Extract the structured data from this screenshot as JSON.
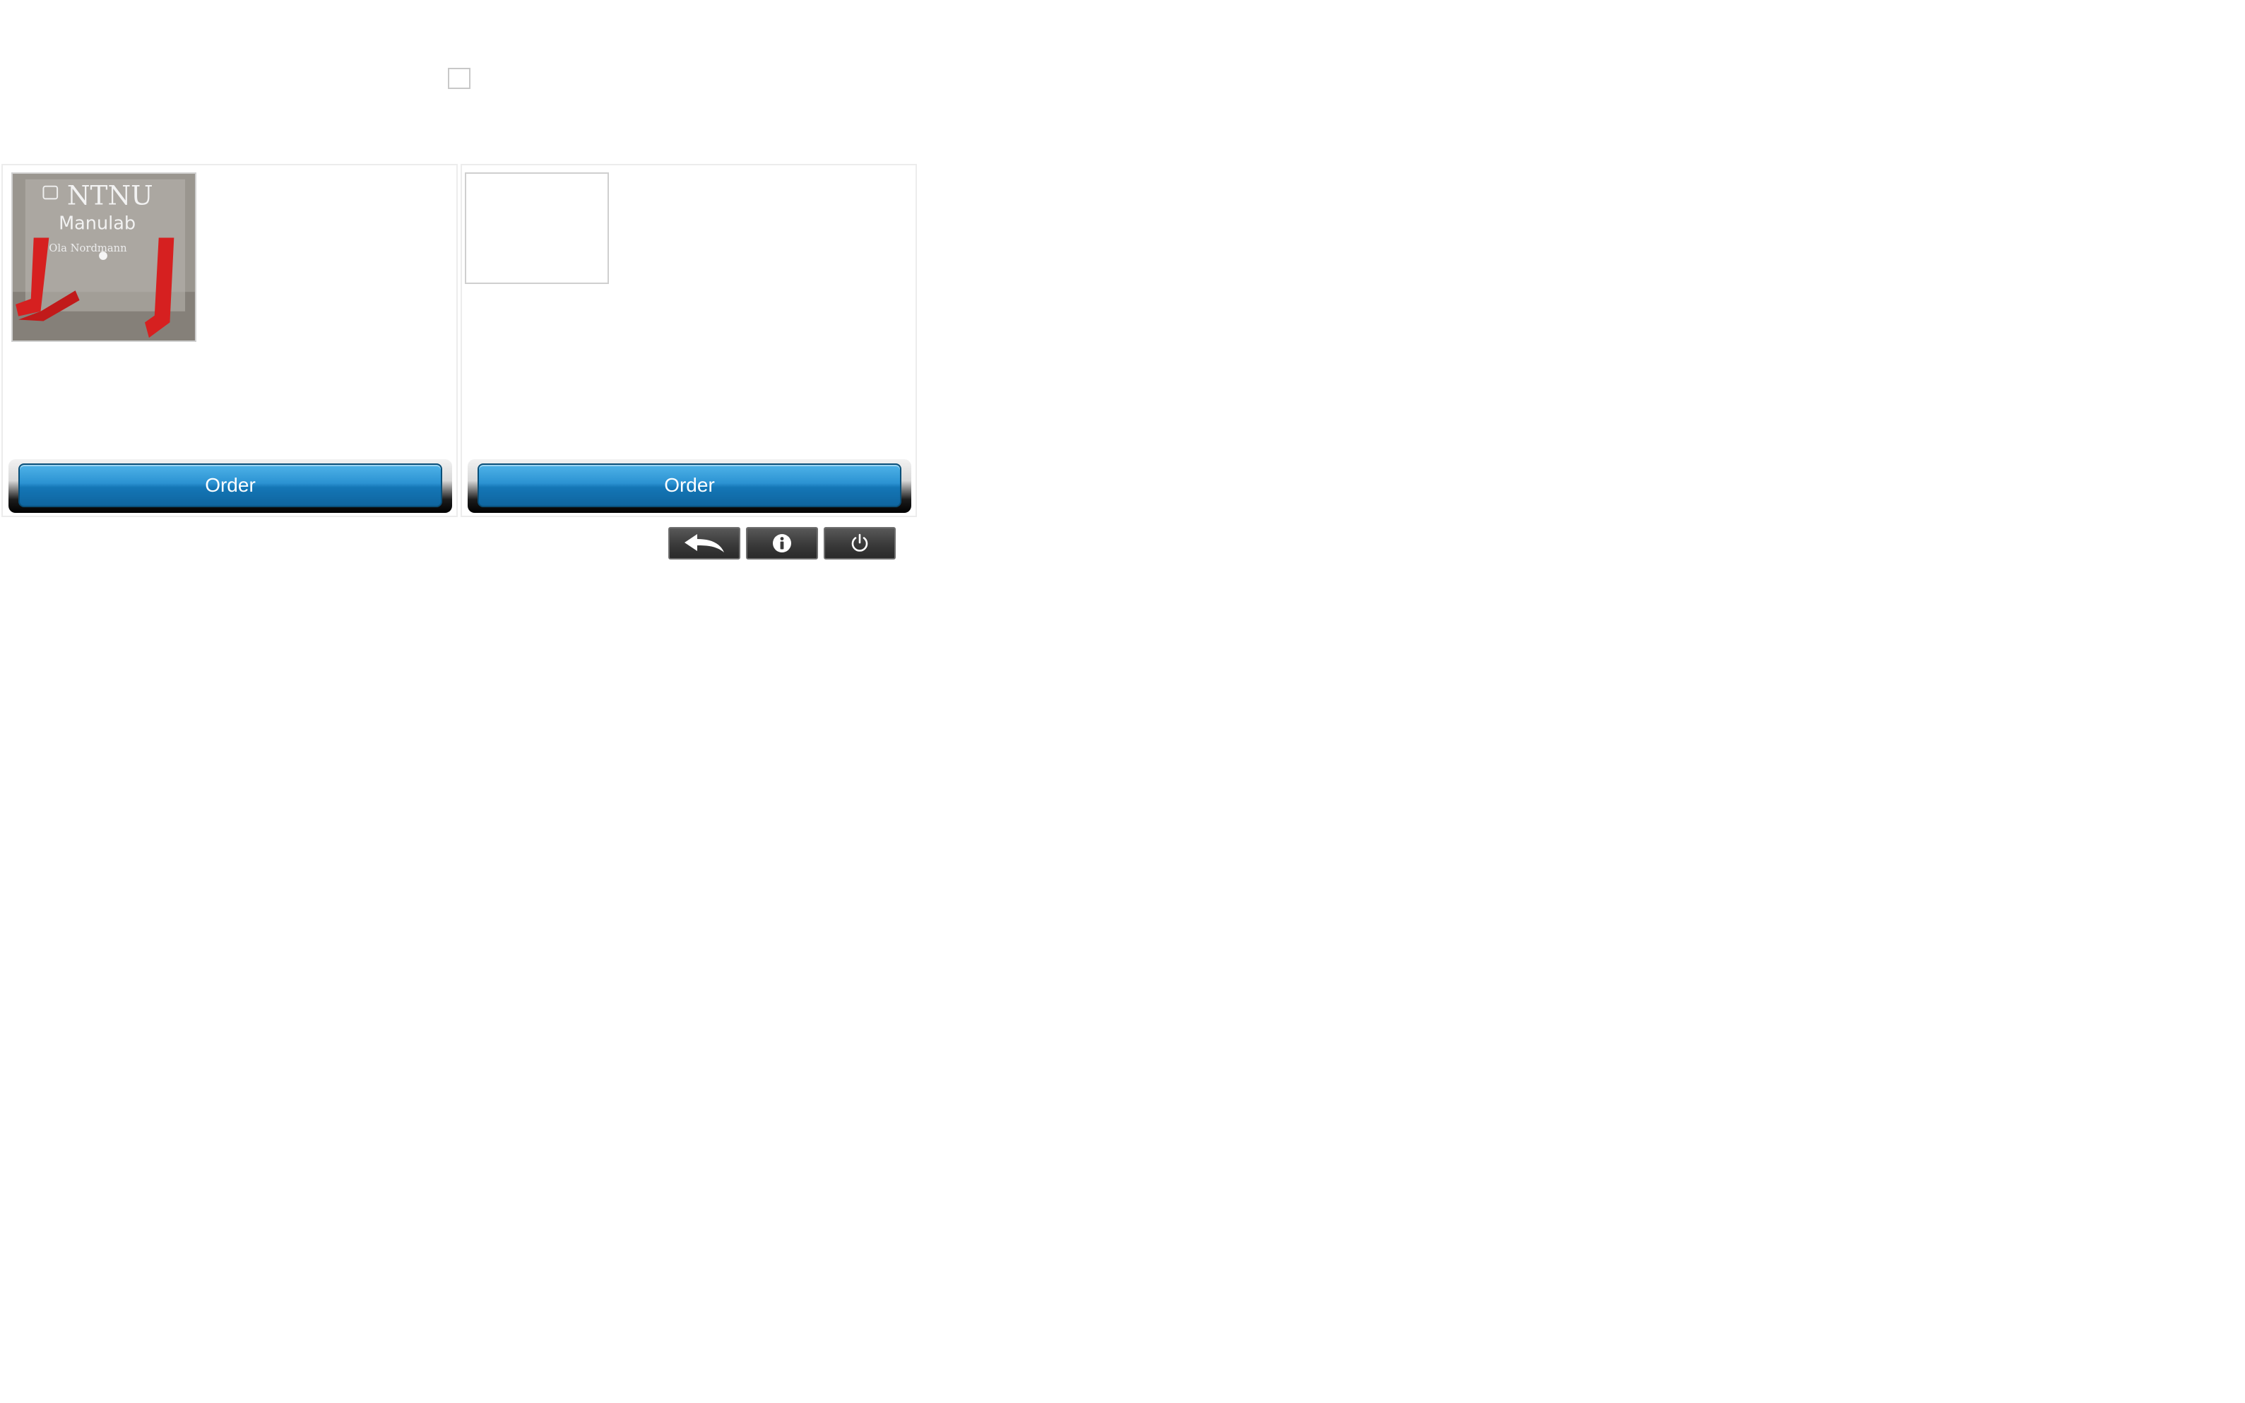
{
  "products": [
    {
      "photo": {
        "name": "NTNU Manulab sign",
        "lettering": [
          "NTNU",
          "Manulab",
          "Ola Nordmann"
        ]
      },
      "order_label": "Order"
    },
    {
      "photo": null,
      "order_label": "Order"
    }
  ],
  "toolbar": {
    "back_icon": "back-arrow-icon",
    "info_icon": "info-icon",
    "power_icon": "power-icon"
  },
  "colors": {
    "order_button": "#1f86c6",
    "toolbar_button": "#3a3a3a",
    "card_border": "#ececec"
  }
}
